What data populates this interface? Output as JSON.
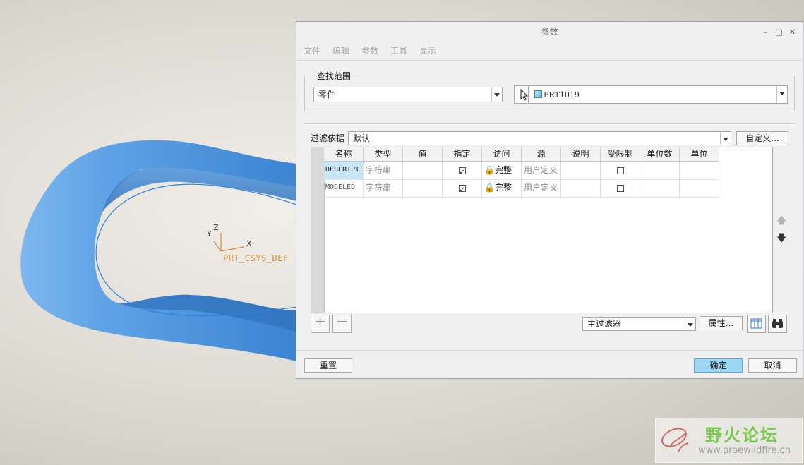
{
  "viewport": {
    "csys_label": "PRT_CSYS_DEF",
    "axis_labels": {
      "x": "X",
      "y": "Y",
      "z": "Z"
    }
  },
  "dialog": {
    "title": "参数",
    "window_buttons": {
      "minimize": "–",
      "maximize": "□",
      "close": "✕"
    },
    "menu": [
      "文件",
      "编辑",
      "参数",
      "工具",
      "显示"
    ],
    "search_scope": {
      "group_title": "查找范围",
      "scope_type": "零件",
      "model_name": "PRT1019"
    },
    "filter": {
      "label": "过滤依据",
      "value": "默认",
      "customize_button": "自定义..."
    },
    "table": {
      "columns": [
        "名称",
        "类型",
        "值",
        "指定",
        "访问",
        "源",
        "说明",
        "受限制",
        "单位数",
        "单位"
      ],
      "rows": [
        {
          "name": "DESCRIPT",
          "type": "字符串",
          "value": "",
          "designate": true,
          "access": "完整",
          "source": "用户定义",
          "description": "",
          "restricted": false,
          "unit_quantity": "",
          "unit": ""
        },
        {
          "name": "MODELED_",
          "type": "字符串",
          "value": "",
          "designate": true,
          "access": "完整",
          "source": "用户定义",
          "description": "",
          "restricted": false,
          "unit_quantity": "",
          "unit": ""
        }
      ]
    },
    "bottom": {
      "main_filter": "主过滤器",
      "properties_button": "属性..."
    },
    "footer": {
      "reset": "重置",
      "ok": "确定",
      "cancel": "取消"
    }
  },
  "watermark": {
    "title": "野火论坛",
    "url": "www.proewildfire.cn"
  },
  "colors": {
    "model_blue": "#4a8fd8",
    "ok_button": "#9fd6f3",
    "selected_cell": "#c7e6f7",
    "csys": "#d48a3a"
  }
}
